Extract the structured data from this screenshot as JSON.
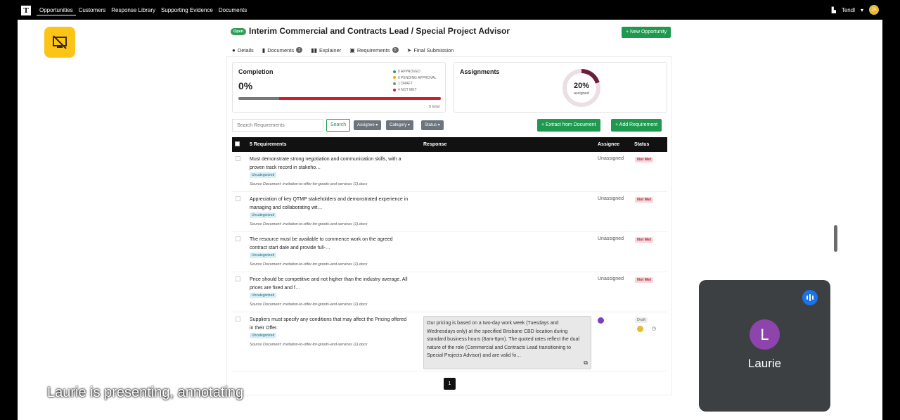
{
  "nav": {
    "logo": "T",
    "links": [
      "Opportunities",
      "Customers",
      "Response Library",
      "Supporting Evidence",
      "Documents"
    ],
    "org": "Tendl",
    "avatar_initials": "JA"
  },
  "header": {
    "badge": "Open",
    "title": "Interim Commercial and Contracts Lead / Special Project Advisor",
    "new_button": "+ New Opportunity"
  },
  "tabs": [
    {
      "label": "Details",
      "icon": "info-icon"
    },
    {
      "label": "Documents",
      "icon": "file-icon",
      "count": "1"
    },
    {
      "label": "Explainer",
      "icon": "book-icon"
    },
    {
      "label": "Requirements",
      "icon": "clipboard-icon",
      "count": "5"
    },
    {
      "label": "Final Submission",
      "icon": "send-icon"
    }
  ],
  "completion": {
    "title": "Completion",
    "percent": "0%",
    "legend": [
      "0 APPROVED",
      "0 PENDING APPROVAL",
      "1 DRAFT",
      "4 NOT MET"
    ],
    "total": "5 total",
    "draft_fraction": 0.2,
    "notmet_fraction": 0.8
  },
  "assignments": {
    "title": "Assignments",
    "percent": "20%",
    "sub": "assigned",
    "fraction": 0.2
  },
  "toolbar": {
    "search_placeholder": "Search Requirements",
    "search_button": "Search",
    "filters": [
      "Assignee",
      "Category",
      "Status"
    ],
    "extract_button": "+ Extract from Document",
    "add_button": "+ Add Requirement"
  },
  "table": {
    "header_requirements": "5 Requirements",
    "header_response": "Response",
    "header_assignee": "Assignee",
    "header_status": "Status",
    "rows": [
      {
        "text": "Must demonstrate strong negotiation and communication skills, with a proven track record in stakeho…",
        "category": "Uncategorized",
        "source": "Source Document: invitation-to-offer-for-goods-and-services (1).docx",
        "assignee": "Unassigned",
        "status": "Not Met"
      },
      {
        "text": "Appreciation of key QTMP stakeholders and demonstrated experience in managing and collaborating wit…",
        "category": "Uncategorized",
        "source": "Source Document: invitation-to-offer-for-goods-and-services (1).docx",
        "assignee": "Unassigned",
        "status": "Not Met"
      },
      {
        "text": "The resource must be available to commence work on the agreed contract start date and provide full-…",
        "category": "Uncategorized",
        "source": "Source Document: invitation-to-offer-for-goods-and-services (1).docx",
        "assignee": "Unassigned",
        "status": "Not Met"
      },
      {
        "text": "Price should be competitive and not higher than the industry average. All prices are fixed and f…",
        "category": "Uncategorized",
        "source": "Source Document: invitation-to-offer-for-goods-and-services (1).docx",
        "assignee": "Unassigned",
        "status": "Not Met"
      },
      {
        "text": "Suppliers must specify any conditions that may affect the Pricing offered in their Offer.",
        "category": "Uncategorized",
        "source": "Source Document: invitation-to-offer-for-goods-and-services (1).docx",
        "response": "Our pricing is based on a two-day work week (Tuesdays and Wednesdays only) at the specified Brisbane CBD location during standard business hours (8am-6pm). The quoted rates reflect the dual nature of the role (Commercial and Contracts Lead transitioning to Special Projects Advisor) and are valid fo…",
        "status": "Draft"
      }
    ],
    "page": "1"
  },
  "meeting": {
    "caption": "Laurie is presenting, annotating",
    "participant_initial": "L",
    "participant_name": "Laurie"
  }
}
